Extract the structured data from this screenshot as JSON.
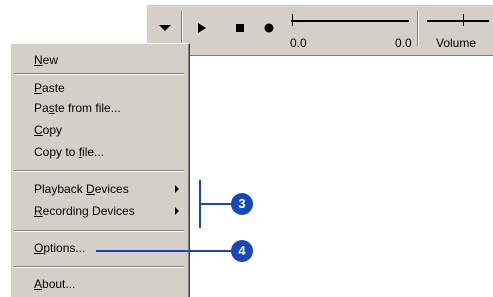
{
  "toolbar": {
    "position_start": "0.0",
    "position_end": "0.0",
    "volume_label": "Volume",
    "position_slider_value": 0.0,
    "volume_slider_value": 0.6
  },
  "menu": {
    "new": {
      "prefix": "",
      "underline": "N",
      "suffix": "ew"
    },
    "paste": {
      "prefix": "",
      "underline": "P",
      "suffix": "aste"
    },
    "paste_from_file": {
      "prefix": "Pa",
      "underline": "s",
      "suffix": "te from file..."
    },
    "copy": {
      "prefix": "",
      "underline": "C",
      "suffix": "opy"
    },
    "copy_to_file": {
      "prefix": "Copy to ",
      "underline": "f",
      "suffix": "ile..."
    },
    "playback_devices": {
      "prefix": "Playback ",
      "underline": "D",
      "suffix": "evices"
    },
    "recording_devices": {
      "prefix": "",
      "underline": "R",
      "suffix": "ecording Devices"
    },
    "options": {
      "prefix": "",
      "underline": "O",
      "suffix": "ptions..."
    },
    "about": {
      "prefix": "",
      "underline": "A",
      "suffix": "bout..."
    }
  },
  "callouts": {
    "devices_badge": "3",
    "options_badge": "4"
  },
  "colors": {
    "callout": "#1a47b8",
    "face": "#d4d0c8"
  }
}
